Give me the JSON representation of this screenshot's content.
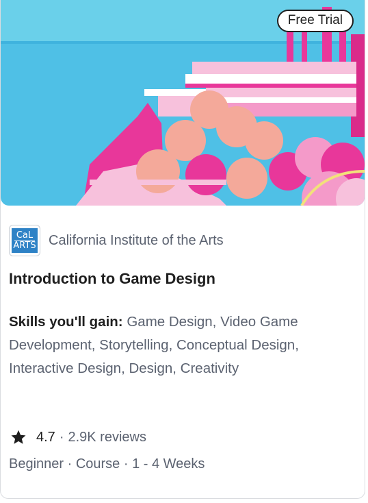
{
  "card": {
    "badge": "Free Trial",
    "partner": {
      "logo_top": "CaL",
      "logo_bottom": "ARTS",
      "name": "California Institute of the Arts"
    },
    "title": "Introduction to Game Design",
    "skills": {
      "label": "Skills you'll gain:",
      "list": "Game Design, Video Game Development, Storytelling, Conceptual Design, Interactive Design, Design, Creativity"
    },
    "rating": {
      "score": "4.7",
      "separator": "·",
      "reviews": "2.9K reviews",
      "icon": "star-icon"
    },
    "meta": "Beginner · Course · 1 - 4 Weeks",
    "colors": {
      "sky": "#4fc0e6",
      "pink": "#e8379a",
      "peach": "#f4a99a",
      "logo_blue": "#2e82c6"
    }
  }
}
